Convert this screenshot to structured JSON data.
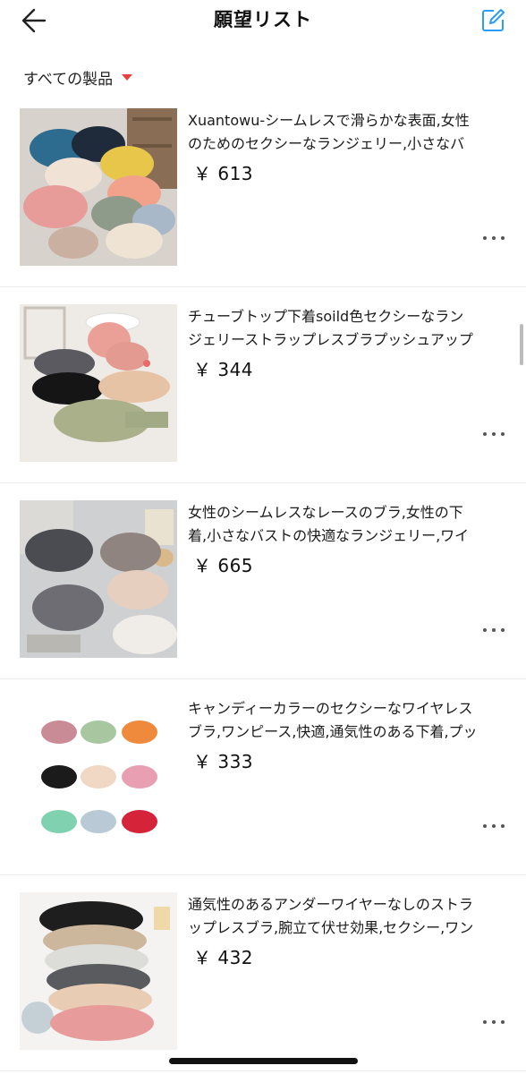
{
  "header": {
    "title": "願望リスト",
    "back_icon": "arrow-left-icon",
    "edit_icon": "edit-square-icon",
    "accent_color": "#2a9df4"
  },
  "filter": {
    "label": "すべての製品",
    "caret_color": "#e8413c"
  },
  "items": [
    {
      "name": "Xuantowu-シームレスで滑らかな表面,女性",
      "name2": "のためのセクシーなランジェリー,小さなバ",
      "price": "￥ 613"
    },
    {
      "name": "チューブトップ下着soild色セクシーなラン",
      "name2": "ジェリーストラップレスブラプッシュアップ",
      "price": "￥ 344"
    },
    {
      "name": "女性のシームレスなレースのブラ,女性の下",
      "name2": "着,小さなバストの快適なランジェリー,ワイ",
      "price": "￥ 665"
    },
    {
      "name": "キャンディーカラーのセクシーなワイヤレス",
      "name2": "ブラ,ワンピース,快適,通気性のある下着,プッ",
      "price": "￥ 333"
    },
    {
      "name": "通気性のあるアンダーワイヤーなしのストラ",
      "name2": "ップレスブラ,腕立て伏せ効果,セクシー,ワン",
      "price": "￥ 432"
    }
  ]
}
